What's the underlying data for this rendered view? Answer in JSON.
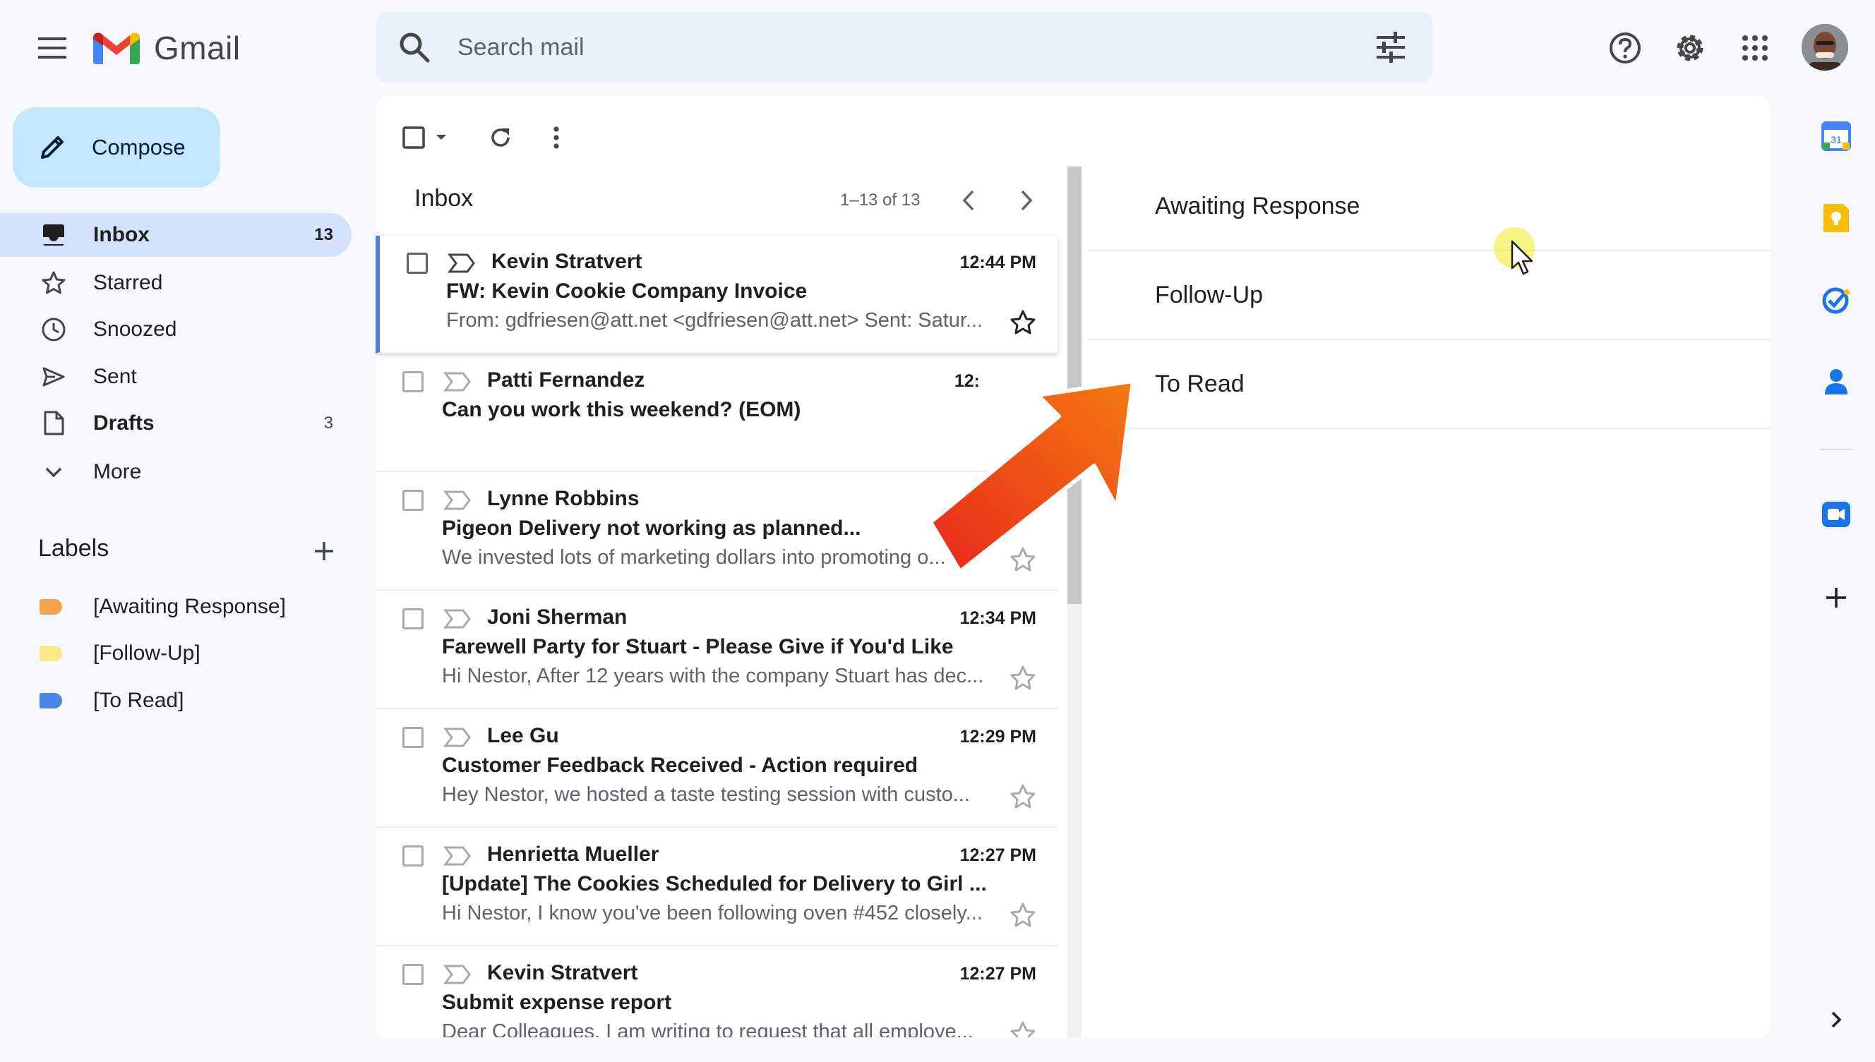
{
  "app": {
    "name": "Gmail"
  },
  "search": {
    "placeholder": "Search mail"
  },
  "compose": {
    "label": "Compose"
  },
  "nav": {
    "items": [
      {
        "label": "Inbox",
        "count": "13",
        "icon": "inbox-icon",
        "active": true
      },
      {
        "label": "Starred",
        "count": "",
        "icon": "star-icon"
      },
      {
        "label": "Snoozed",
        "count": "",
        "icon": "clock-icon"
      },
      {
        "label": "Sent",
        "count": "",
        "icon": "send-icon"
      },
      {
        "label": "Drafts",
        "count": "3",
        "icon": "draft-icon"
      },
      {
        "label": "More",
        "count": "",
        "icon": "chevron-down-icon"
      }
    ]
  },
  "labels": {
    "heading": "Labels",
    "items": [
      {
        "label": "[Awaiting Response]",
        "color": "#f2a44b"
      },
      {
        "label": "[Follow-Up]",
        "color": "#fbe983"
      },
      {
        "label": "[To Read]",
        "color": "#4a86e8"
      }
    ]
  },
  "list": {
    "title": "Inbox",
    "pager": "1–13 of 13",
    "emails": [
      {
        "sender": "Kevin Stratvert",
        "time": "12:44 PM",
        "subject": "FW: Kevin Cookie Company Invoice",
        "snippet": "From: gdfriesen@att.net <gdfriesen@att.net> Sent: Satur..."
      },
      {
        "sender": "Patti Fernandez",
        "time": "12:",
        "subject": "Can you work this weekend? (EOM)",
        "snippet": ""
      },
      {
        "sender": "Lynne Robbins",
        "time": "",
        "subject": "Pigeon Delivery not working as planned...",
        "snippet": "We invested lots of marketing dollars into promoting o..."
      },
      {
        "sender": "Joni Sherman",
        "time": "12:34 PM",
        "subject": "Farewell Party for Stuart - Please Give if You'd Like",
        "snippet": "Hi Nestor, After 12 years with the company Stuart has dec..."
      },
      {
        "sender": "Lee Gu",
        "time": "12:29 PM",
        "subject": "Customer Feedback Received - Action required",
        "snippet": "Hey Nestor, we hosted a taste testing session with custo..."
      },
      {
        "sender": "Henrietta Mueller",
        "time": "12:27 PM",
        "subject": "[Update] The Cookies Scheduled for Delivery to Girl ...",
        "snippet": "Hi Nestor, I know you've been following oven #452 closely..."
      },
      {
        "sender": "Kevin Stratvert",
        "time": "12:27 PM",
        "subject": "Submit expense report",
        "snippet": "Dear Colleagues, I am writing to request that all employe..."
      }
    ]
  },
  "submenu": {
    "items": [
      "Awaiting Response",
      "Follow-Up",
      "To Read"
    ]
  },
  "colors": {
    "accent": "#0b57d0",
    "compose_bg": "#c2e7ff",
    "active_nav": "#d3e3fd",
    "arrow_start": "#e8281e",
    "arrow_end": "#f47a0f"
  }
}
